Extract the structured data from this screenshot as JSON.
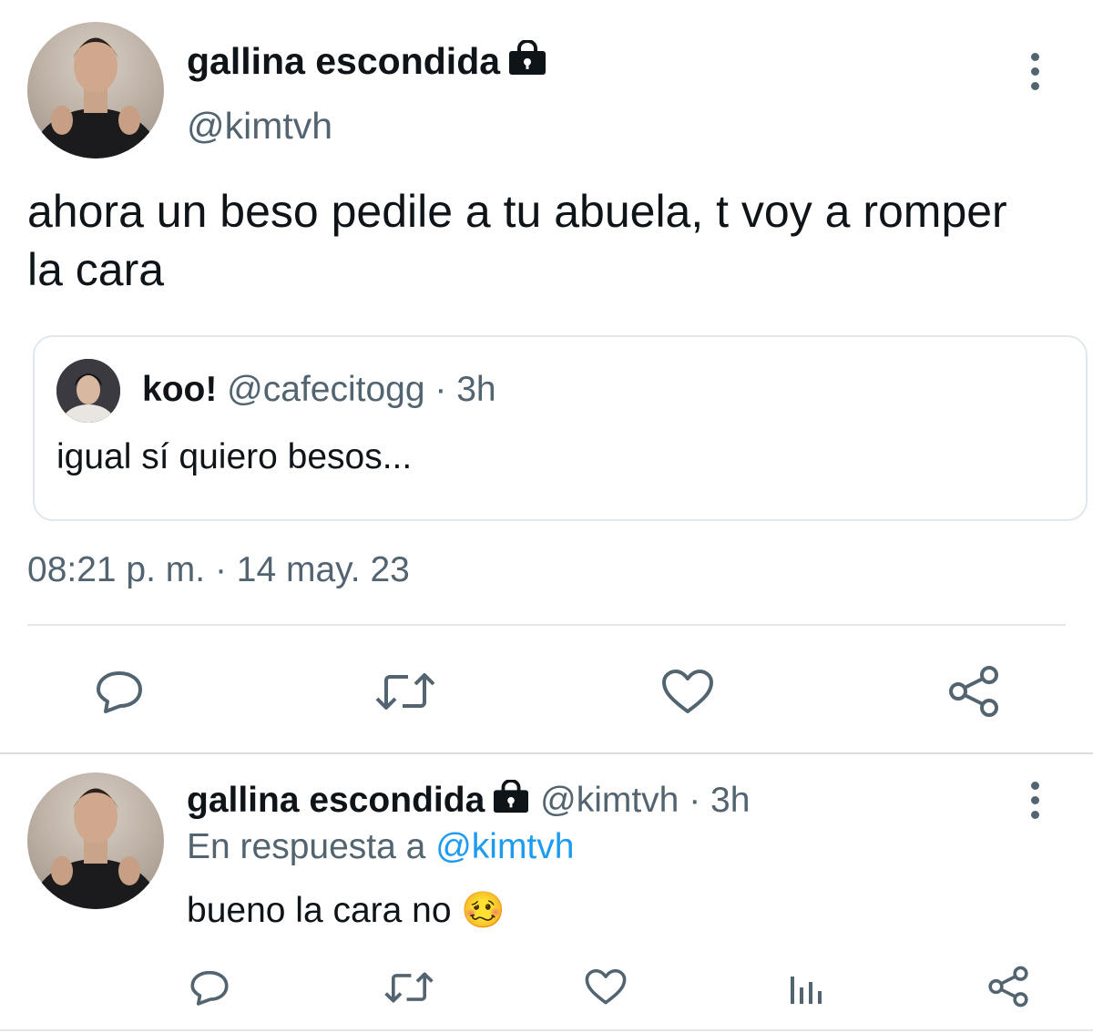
{
  "main_tweet": {
    "display_name": "gallina escondida",
    "handle": "@kimtvh",
    "text": "ahora un beso pedile a tu abuela, t voy a romper la cara",
    "timestamp": "08:21 p. m. · 14 may. 23",
    "protected_icon": "lock-icon",
    "menu_icon": "more-vertical-icon"
  },
  "quoted_tweet": {
    "display_name": "koo!",
    "handle": "@cafecitogg",
    "time": "· 3h",
    "text": "igual sí quiero besos..."
  },
  "main_actions": [
    "reply-icon",
    "retweet-icon",
    "like-icon",
    "share-icon"
  ],
  "reply_tweet": {
    "display_name": "gallina escondida",
    "handle": "@kimtvh",
    "time": "· 3h",
    "reply_prefix": "En respuesta a",
    "reply_to": "@kimtvh",
    "text": "bueno la cara no",
    "emoji": "🥴"
  },
  "reply_actions": [
    "reply-icon",
    "retweet-icon",
    "like-icon",
    "analytics-icon",
    "share-icon"
  ],
  "colors": {
    "text": "#0f1419",
    "secondary": "#536471",
    "link": "#1d9bf0",
    "border": "#e1e8ed"
  }
}
